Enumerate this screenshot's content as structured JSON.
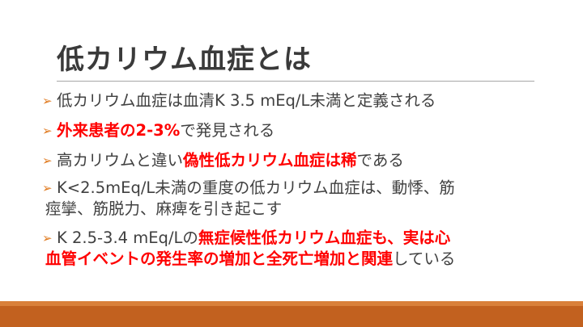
{
  "slide": {
    "title": "低カリウム血症とは",
    "bullet_marker": "➢",
    "bullets": [
      {
        "text": "低カリウム血症は血清K 3.5 mEq/L未満と定義される"
      },
      {
        "em": "外来患者の2-3%",
        "tail": "で発見される"
      },
      {
        "head": "高カリウムと違い",
        "em": "偽性低カリウム血症は稀",
        "tail": "である"
      },
      {
        "line1": "K<2.5mEq/L未満の重度の低カリウム血症は、動悸、筋",
        "line2": "痙攣、筋脱力、麻痺を引き起こす"
      },
      {
        "head": "K 2.5-3.4 mEq/Lの",
        "em1": "無症候性低カリウム血症も、実は心",
        "em2": "血管イベントの発生率の増加と全死亡増加と関連",
        "tail": "している"
      }
    ]
  },
  "colors": {
    "accent": "#e07a1f",
    "emphasis": "#ff0000",
    "footer_bar": "#c2611f",
    "footer_stripe": "#d9803a",
    "rule": "#a6a6a6"
  }
}
